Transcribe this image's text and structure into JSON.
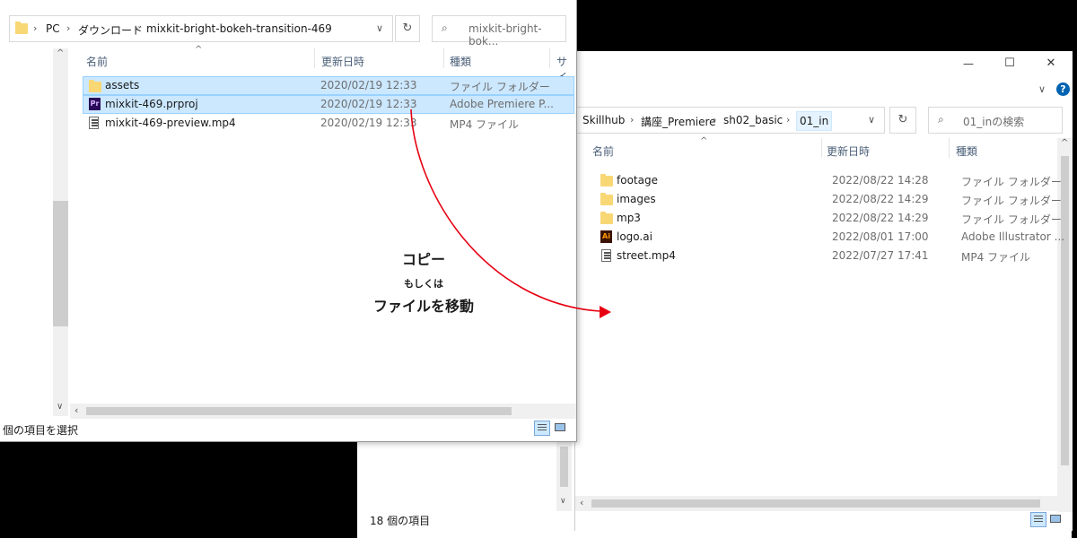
{
  "left_window": {
    "breadcrumb": [
      "PC",
      "ダウンロード",
      "mixkit-bright-bokeh-transition-469"
    ],
    "search_placeholder": "mixkit-bright-bok...",
    "refresh_icon": "↻",
    "dropdown_icon": "∨",
    "columns": [
      "名前",
      "更新日時",
      "種類",
      "サイ"
    ],
    "files": [
      {
        "name": "assets",
        "date": "2020/02/19 12:33",
        "type": "ファイル フォルダー",
        "icon": "folder-icon",
        "selected": true
      },
      {
        "name": "mixkit-469.prproj",
        "date": "2020/02/19 12:33",
        "type": "Adobe Premiere P...",
        "icon": "premiere-file-icon",
        "selected": true
      },
      {
        "name": "mixkit-469-preview.mp4",
        "date": "2020/02/19 12:33",
        "type": "MP4 ファイル",
        "icon": "video-file-icon",
        "selected": false
      }
    ],
    "status_text": "個の項目を選択"
  },
  "right_window": {
    "title_buttons": {
      "minimize": "—",
      "maximize": "☐",
      "close": "✕"
    },
    "breadcrumb": [
      "Skillhub",
      "講座_Premiere",
      "sh02_basic",
      "01_in"
    ],
    "search_placeholder": "01_inの検索",
    "columns": [
      "名前",
      "更新日時",
      "種類"
    ],
    "files": [
      {
        "name": "footage",
        "date": "2022/08/22 14:28",
        "type": "ファイル フォルダー",
        "icon": "folder-icon"
      },
      {
        "name": "images",
        "date": "2022/08/22 14:29",
        "type": "ファイル フォルダー",
        "icon": "folder-icon"
      },
      {
        "name": "mp3",
        "date": "2022/08/22 14:29",
        "type": "ファイル フォルダー",
        "icon": "folder-icon"
      },
      {
        "name": "logo.ai",
        "date": "2022/08/01 17:00",
        "type": "Adobe Illustrator ...",
        "icon": "illustrator-file-icon"
      },
      {
        "name": "street.mp4",
        "date": "2022/07/27 17:41",
        "type": "MP4 ファイル",
        "icon": "video-file-icon"
      }
    ]
  },
  "back_window": {
    "status_text": "18 個の項目"
  },
  "annotation": {
    "line1": "コピー",
    "line2": "もしくは",
    "line3": "ファイルを移動",
    "arrow_color": "#e60012"
  },
  "icon_labels": {
    "premiere": "Pr",
    "illustrator": "Ai"
  }
}
